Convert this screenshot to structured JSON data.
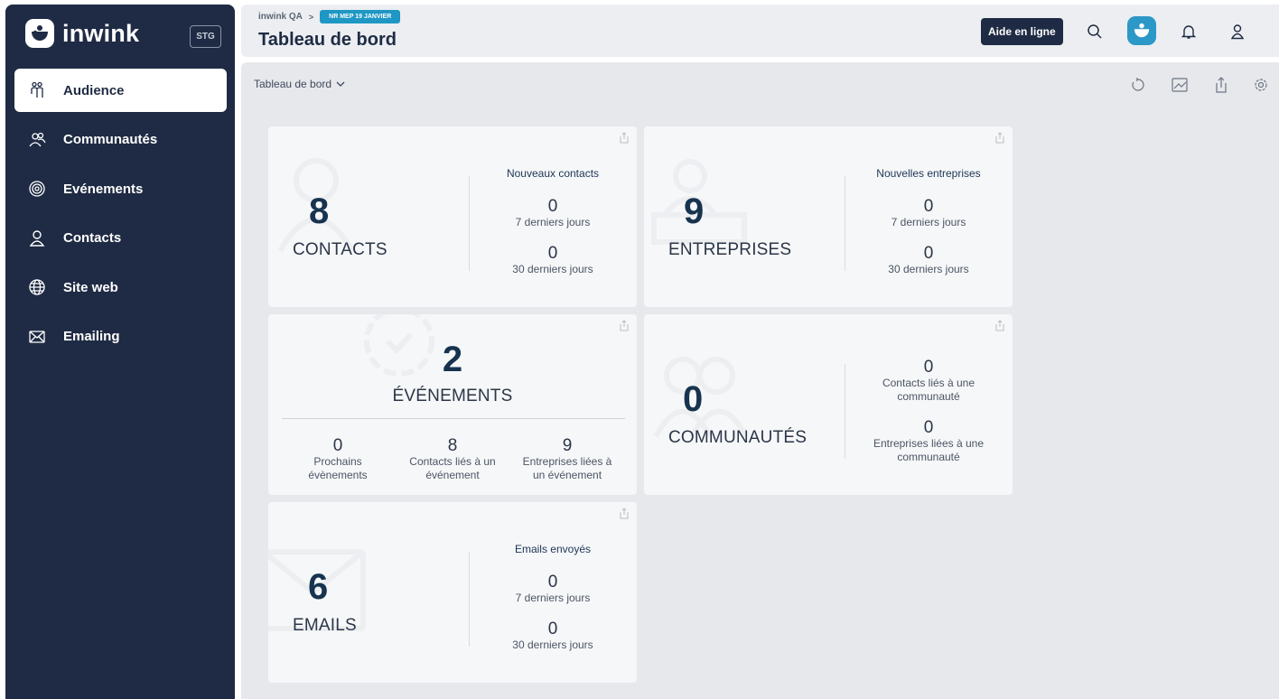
{
  "sidebar": {
    "brand": "inwink",
    "env_badge": "STG",
    "items": [
      {
        "label": "Audience",
        "icon": "audience-icon",
        "active": true
      },
      {
        "label": "Communautés",
        "icon": "communities-icon"
      },
      {
        "label": "Evénements",
        "icon": "events-icon"
      },
      {
        "label": "Contacts",
        "icon": "contacts-icon"
      },
      {
        "label": "Site web",
        "icon": "globe-icon"
      },
      {
        "label": "Emailing",
        "icon": "mail-icon"
      }
    ]
  },
  "header": {
    "breadcrumb": {
      "root": "inwink QA",
      "separator": ">",
      "tag": "NR MEP 19 JANVIER"
    },
    "title": "Tableau de bord",
    "help_label": "Aide en ligne"
  },
  "toolbar": {
    "dashboard_select": "Tableau de bord"
  },
  "cards": {
    "contacts": {
      "value": "8",
      "label": "CONTACTS",
      "side_title": "Nouveaux contacts",
      "stat1_value": "0",
      "stat1_label": "7 derniers jours",
      "stat2_value": "0",
      "stat2_label": "30 derniers jours"
    },
    "entreprises": {
      "value": "9",
      "label": "ENTREPRISES",
      "side_title": "Nouvelles entreprises",
      "stat1_value": "0",
      "stat1_label": "7 derniers jours",
      "stat2_value": "0",
      "stat2_label": "30 derniers jours"
    },
    "evenements": {
      "value": "2",
      "label": "ÉVÉNEMENTS",
      "stat1_value": "0",
      "stat1_label_l1": "Prochains",
      "stat1_label_l2": "évènements",
      "stat2_value": "8",
      "stat2_label_l1": "Contacts liés à un",
      "stat2_label_l2": "événement",
      "stat3_value": "9",
      "stat3_label_l1": "Entreprises liées à",
      "stat3_label_l2": "un événement"
    },
    "communautes": {
      "value": "0",
      "label": "COMMUNAUTÉS",
      "stat1_value": "0",
      "stat1_label_l1": "Contacts liés à une",
      "stat1_label_l2": "communauté",
      "stat2_value": "0",
      "stat2_label_l1": "Entreprises liées à une",
      "stat2_label_l2": "communauté"
    },
    "emails": {
      "value": "6",
      "label": "EMAILS",
      "side_title": "Emails envoyés",
      "stat1_value": "0",
      "stat1_label": "7 derniers jours",
      "stat2_value": "0",
      "stat2_label": "30 derniers jours"
    }
  },
  "colors": {
    "sidebar_bg": "#1f2b44",
    "accent": "#1f97c4",
    "number": "#17334f"
  }
}
